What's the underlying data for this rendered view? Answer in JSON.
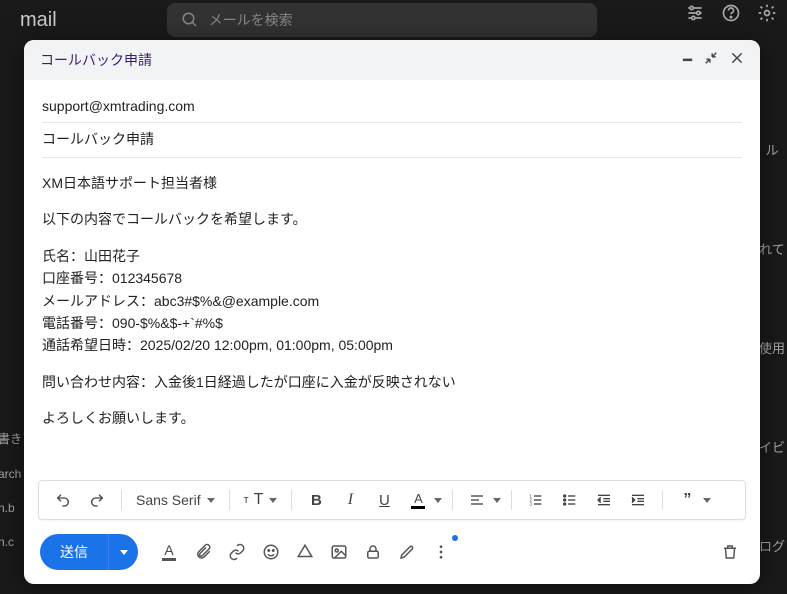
{
  "header": {
    "app_label": "mail",
    "search_placeholder": "メールを検索"
  },
  "window": {
    "title": "コールバック申請"
  },
  "fields": {
    "to": "support@xmtrading.com",
    "subject": "コールバック申請"
  },
  "body": {
    "greeting": "XM日本語サポート担当者様",
    "intro": "以下の内容でコールバックを希望します。",
    "name_line": "氏名：山田花子",
    "account_line": "口座番号：012345678",
    "email_line": "メールアドレス：abc3#$%&@example.com",
    "phone_line": "電話番号：090-$%&$-+`#%$",
    "pref_time_line": "通話希望日時：2025/02/20 12:00pm, 01:00pm, 05:00pm",
    "inquiry_line": "問い合わせ内容：入金後1日経過したが口座に入金が反映されない",
    "closing": "よろしくお願いします。"
  },
  "toolbar": {
    "font_label": "Sans Serif",
    "size_glyph": "тT"
  },
  "send": {
    "label": "送信"
  },
  "bg_left": {
    "l1": "書き",
    "l2": "arch",
    "l3": "n.b",
    "l4": "n.c"
  },
  "bg_side": {
    "s1": "ル",
    "s2": "れて",
    "s3": "使用",
    "s4": "イビ",
    "s5": "ログ"
  }
}
